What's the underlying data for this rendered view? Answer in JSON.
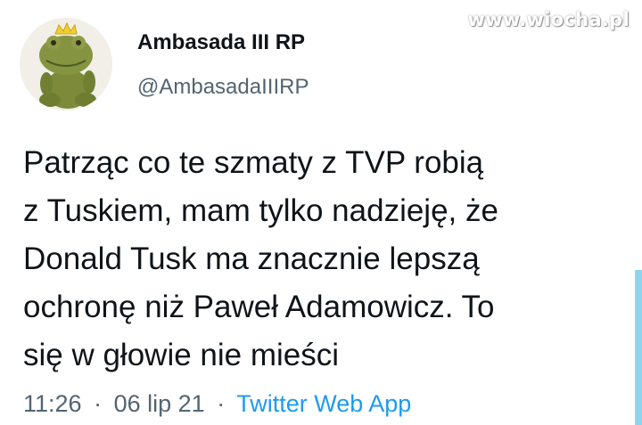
{
  "watermark": "www.wiocha.pl",
  "author": {
    "display_name": "Ambasada III RP",
    "handle": "@AmbasadaIIIRP",
    "avatar_icon": "frog-plush-with-crown-icon"
  },
  "tweet": {
    "lines": [
      "Patrząc co te szmaty z TVP robią",
      "z Tuskiem, mam tylko nadzieję, że",
      "Donald Tusk ma znacznie lepszą",
      "ochronę niż Paweł Adamowicz. To",
      "się w głowie nie mieści"
    ]
  },
  "meta": {
    "time": "11:26",
    "date": "06 lip 21",
    "separator": "·",
    "source": "Twitter Web App"
  },
  "colors": {
    "text": "#0f1419",
    "secondary": "#536471",
    "link": "#1d9bf0",
    "scroll_accent": "#8fd4ee"
  }
}
